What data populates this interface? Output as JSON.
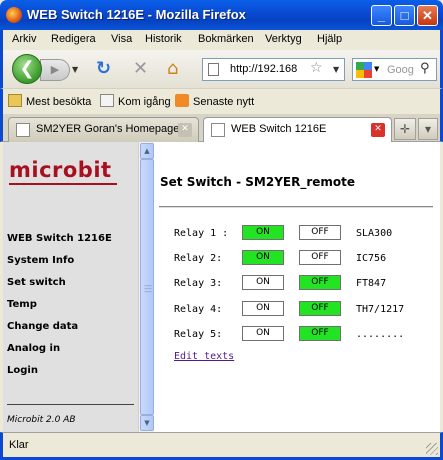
{
  "window": {
    "title": "WEB Switch 1216E - Mozilla Firefox",
    "minimize_glyph": "_",
    "maximize_glyph": "□",
    "close_glyph": "✕"
  },
  "menu": [
    "Arkiv",
    "Redigera",
    "Visa",
    "Historik",
    "Bokmärken",
    "Verktyg",
    "Hjälp"
  ],
  "nav": {
    "url": "http://192.168",
    "search_placeholder": "Goog"
  },
  "bookmarks": [
    "Mest besökta",
    "Kom igång",
    "Senaste nytt"
  ],
  "tabs": [
    {
      "label": "SM2YER Goran's Homepage",
      "active": false
    },
    {
      "label": "WEB Switch 1216E",
      "active": true
    }
  ],
  "sidebar": {
    "logo": "microbit",
    "links": [
      "WEB Switch 1216E",
      "System Info",
      "Set switch",
      "Temp",
      "Change data",
      "Analog in",
      "Login"
    ],
    "footer": "Microbit 2.0 AB"
  },
  "main": {
    "title": "Set Switch - SM2YER_remote",
    "relays": [
      {
        "label": "Relay 1 :",
        "on": "ON",
        "off": "OFF",
        "state": "on",
        "desc": "SLA300"
      },
      {
        "label": "Relay 2:",
        "on": "ON",
        "off": "OFF",
        "state": "on",
        "desc": "IC756"
      },
      {
        "label": "Relay 3:",
        "on": "ON",
        "off": "OFF",
        "state": "off",
        "desc": "FT847"
      },
      {
        "label": "Relay 4:",
        "on": "ON",
        "off": "OFF",
        "state": "off",
        "desc": "TH7/1217"
      },
      {
        "label": "Relay 5:",
        "on": "ON",
        "off": "OFF",
        "state": "off",
        "desc": "........"
      }
    ],
    "edit_link": "Edit texts"
  },
  "status": {
    "text": "Klar"
  },
  "colors": {
    "active_state": "#22e422",
    "logo": "#a81020",
    "titlebar": "#0a49d0"
  }
}
